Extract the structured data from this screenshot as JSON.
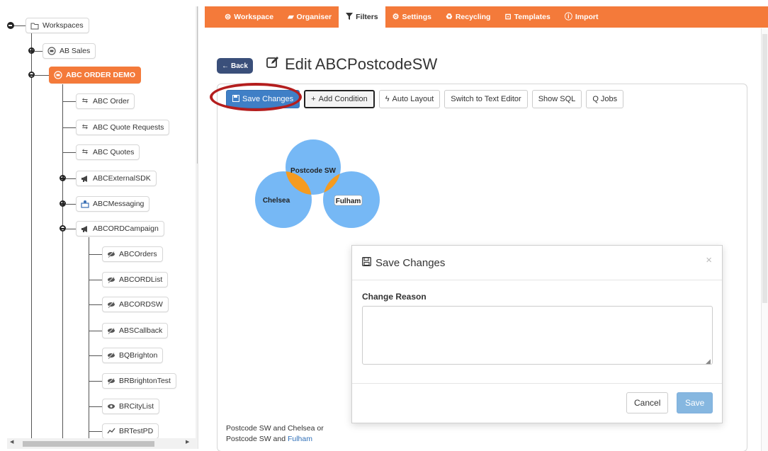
{
  "colors": {
    "accent": "#f47a3a",
    "primary": "#3f7fc6",
    "back": "#3a4f7a",
    "highlight": "#b41e1e",
    "venn": "#76b8f5",
    "venn_overlap": "#f59b20"
  },
  "tree": {
    "root": {
      "label": "Workspaces",
      "icon": "folder-open-icon"
    },
    "items": [
      {
        "label": "AB Sales",
        "icon": "workspace-icon"
      },
      {
        "label": "ABC ORDER DEMO",
        "icon": "workspace-icon",
        "active": true
      },
      {
        "label": "ABC Order",
        "icon": "relation-icon"
      },
      {
        "label": "ABC Quote Requests",
        "icon": "relation-icon"
      },
      {
        "label": "ABC Quotes",
        "icon": "relation-icon"
      },
      {
        "label": "ABCExternalSDK",
        "icon": "megaphone-icon"
      },
      {
        "label": "ABCMessaging",
        "icon": "messaging-icon"
      },
      {
        "label": "ABCORDCampaign",
        "icon": "megaphone-icon"
      },
      {
        "label": "ABCOrders",
        "icon": "hidden-filter-icon"
      },
      {
        "label": "ABCORDList",
        "icon": "hidden-filter-icon"
      },
      {
        "label": "ABCORDSW",
        "icon": "hidden-filter-icon"
      },
      {
        "label": "ABSCallback",
        "icon": "hidden-filter-icon"
      },
      {
        "label": "BQBrighton",
        "icon": "hidden-filter-icon"
      },
      {
        "label": "BRBrightonTest",
        "icon": "hidden-filter-icon"
      },
      {
        "label": "BRCityList",
        "icon": "eye-icon"
      },
      {
        "label": "BRTestPD",
        "icon": "chart-icon"
      }
    ]
  },
  "nav": {
    "tabs": [
      {
        "label": "Workspace",
        "icon": "workspace-icon"
      },
      {
        "label": "Organiser",
        "icon": "book-icon"
      },
      {
        "label": "Filters",
        "icon": "filter-icon",
        "active": true
      },
      {
        "label": "Settings",
        "icon": "gear-icon"
      },
      {
        "label": "Recycling",
        "icon": "recycle-icon"
      },
      {
        "label": "Templates",
        "icon": "templates-icon"
      },
      {
        "label": "Import",
        "icon": "import-icon"
      }
    ]
  },
  "header": {
    "back_label": "Back",
    "title": "Edit ABCPostcodeSW"
  },
  "toolbar": {
    "save_changes": "Save Changes",
    "add_condition": "Add Condition",
    "auto_layout": "Auto Layout",
    "text_editor": "Switch to Text Editor",
    "show_sql": "Show SQL",
    "q_jobs": "Q Jobs"
  },
  "venn": {
    "top": "Postcode SW",
    "left": "Chelsea",
    "right": "Fulham"
  },
  "expression": {
    "line1": "Postcode SW and Chelsea or",
    "line2_prefix": "Postcode SW and ",
    "line2_link": "Fulham"
  },
  "modal": {
    "title": "Save Changes",
    "close": "×",
    "reason_label": "Change Reason",
    "reason_value": "",
    "cancel_label": "Cancel",
    "save_label": "Save"
  }
}
